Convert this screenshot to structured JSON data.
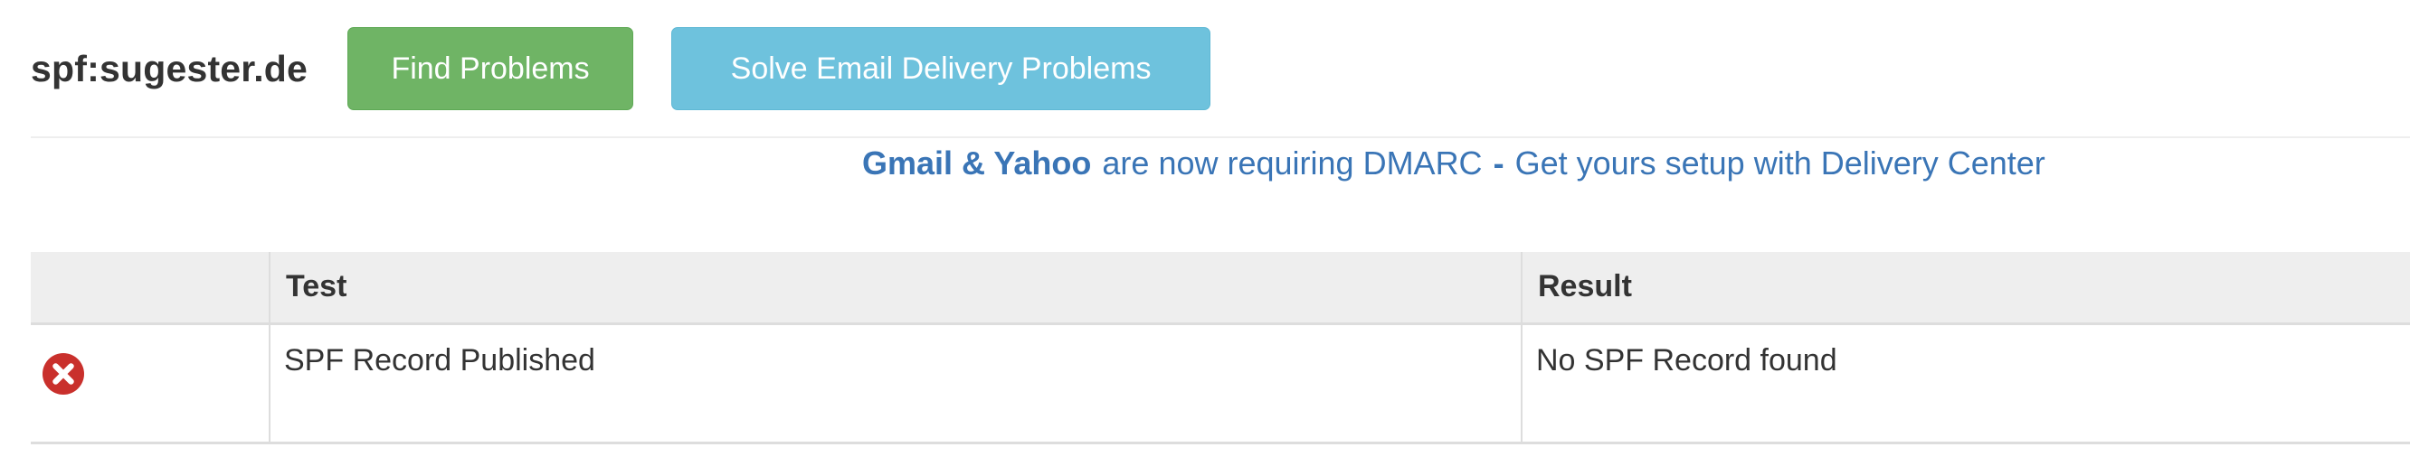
{
  "header": {
    "title": "spf:sugester.de",
    "find_problems_label": "Find Problems",
    "solve_delivery_label": "Solve Email Delivery Problems"
  },
  "banner": {
    "brands": "Gmail & Yahoo",
    "middle": "are now requiring DMARC",
    "separator": "-",
    "cta": "Get yours setup with Delivery Center"
  },
  "results_table": {
    "columns": [
      "",
      "Test",
      "Result"
    ],
    "rows": [
      {
        "status_icon": "error-circle-x-icon",
        "test": "SPF Record Published",
        "result": "No SPF Record found"
      }
    ]
  },
  "colors": {
    "find_button": "#6fb465",
    "solve_button": "#6ec2dd",
    "link": "#3a75b6",
    "error": "#c9302c",
    "header_row_bg": "#eeeeee"
  }
}
